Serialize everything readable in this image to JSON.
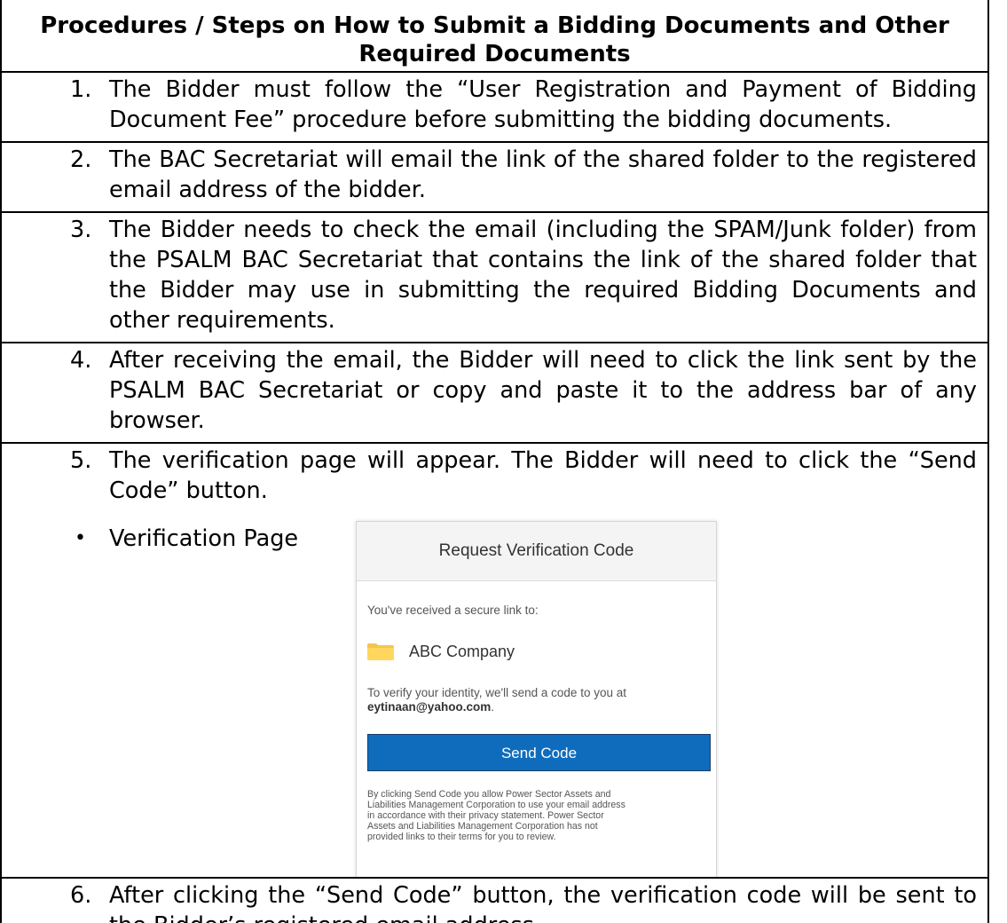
{
  "title_line1": "Procedures / Steps on How to Submit a Bidding Documents and Other",
  "title_line2": "Required Documents",
  "steps": [
    {
      "num": "1.",
      "text": "The Bidder must follow the “User Registration and Payment of Bidding Document Fee” procedure before submitting the bidding documents."
    },
    {
      "num": "2.",
      "text": "The BAC Secretariat will email the link of the shared folder to the registered email address of the bidder."
    },
    {
      "num": "3.",
      "text": "The Bidder needs to check the email (including the SPAM/Junk folder) from the PSALM BAC Secretariat that contains the link of the shared folder that the Bidder may use in submitting the required Bidding Documents and other requirements."
    },
    {
      "num": "4.",
      "text": "After receiving the email, the Bidder will need to click the link sent by the PSALM BAC Secretariat or copy and paste it to the address bar of any browser."
    },
    {
      "num": "5.",
      "text": "The verification page will appear. The Bidder will need to click the “Send Code” button."
    },
    {
      "num": "6.",
      "text": "After clicking the “Send Code” button, the verification code will be sent to the Bidder’s registered email address."
    }
  ],
  "bullet": {
    "symbol": "•",
    "label": "Verification Page"
  },
  "dialog": {
    "heading": "Request Verification Code",
    "received": "You've received a secure link to:",
    "folder_icon": "folder-icon",
    "folder_name": "ABC Company",
    "verify_prefix": "To verify your identity, we'll send a code to you at ",
    "email": "eytinaan@yahoo.com",
    "verify_suffix": ".",
    "button_label": "Send Code",
    "button_color": "#0f6cbd",
    "note": "By clicking Send Code you allow Power Sector Assets and Liabilities Management Corporation to use your email address in accordance with their privacy statement. Power Sector Assets and Liabilities Management Corporation has not provided links to their terms for you to review."
  }
}
